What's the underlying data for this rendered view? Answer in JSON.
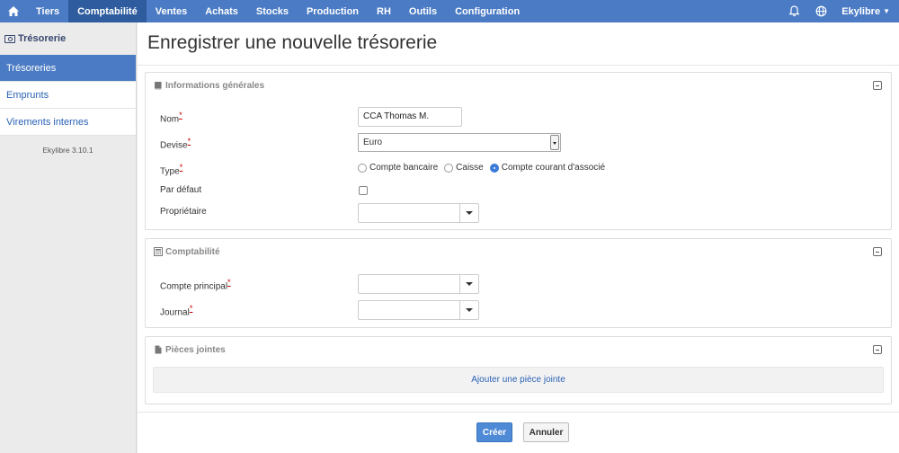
{
  "topnav": {
    "items": [
      "Tiers",
      "Comptabilité",
      "Ventes",
      "Achats",
      "Stocks",
      "Production",
      "RH",
      "Outils",
      "Configuration"
    ],
    "active": "Comptabilité",
    "user": "Ekylibre"
  },
  "sidebar": {
    "header": "Trésorerie",
    "items": [
      {
        "label": "Trésoreries",
        "active": true
      },
      {
        "label": "Emprunts",
        "active": false
      },
      {
        "label": "Virements internes",
        "active": false
      }
    ],
    "version": "Ekylibre 3.10.1"
  },
  "page": {
    "title": "Enregistrer une nouvelle trésorerie"
  },
  "general": {
    "title": "Informations générales",
    "nom_label": "Nom",
    "nom_value": "CCA Thomas M.",
    "devise_label": "Devise",
    "devise_value": "Euro",
    "type_label": "Type",
    "type_options": [
      "Compte bancaire",
      "Caisse",
      "Compte courant d'associé"
    ],
    "type_selected": "Compte courant d'associé",
    "default_label": "Par défaut",
    "owner_label": "Propriétaire",
    "required_mark": "*"
  },
  "accounting": {
    "title": "Comptabilité",
    "account_label": "Compte principal",
    "journal_label": "Journal"
  },
  "attachments": {
    "title": "Pièces jointes",
    "add_label": "Ajouter une pièce jointe"
  },
  "actions": {
    "create": "Créer",
    "cancel": "Annuler"
  },
  "colors": {
    "nav": "#4a7bc4",
    "nav_active": "#2e5c9e",
    "link": "#2a62b5",
    "primary_button": "#4f8ad6"
  }
}
